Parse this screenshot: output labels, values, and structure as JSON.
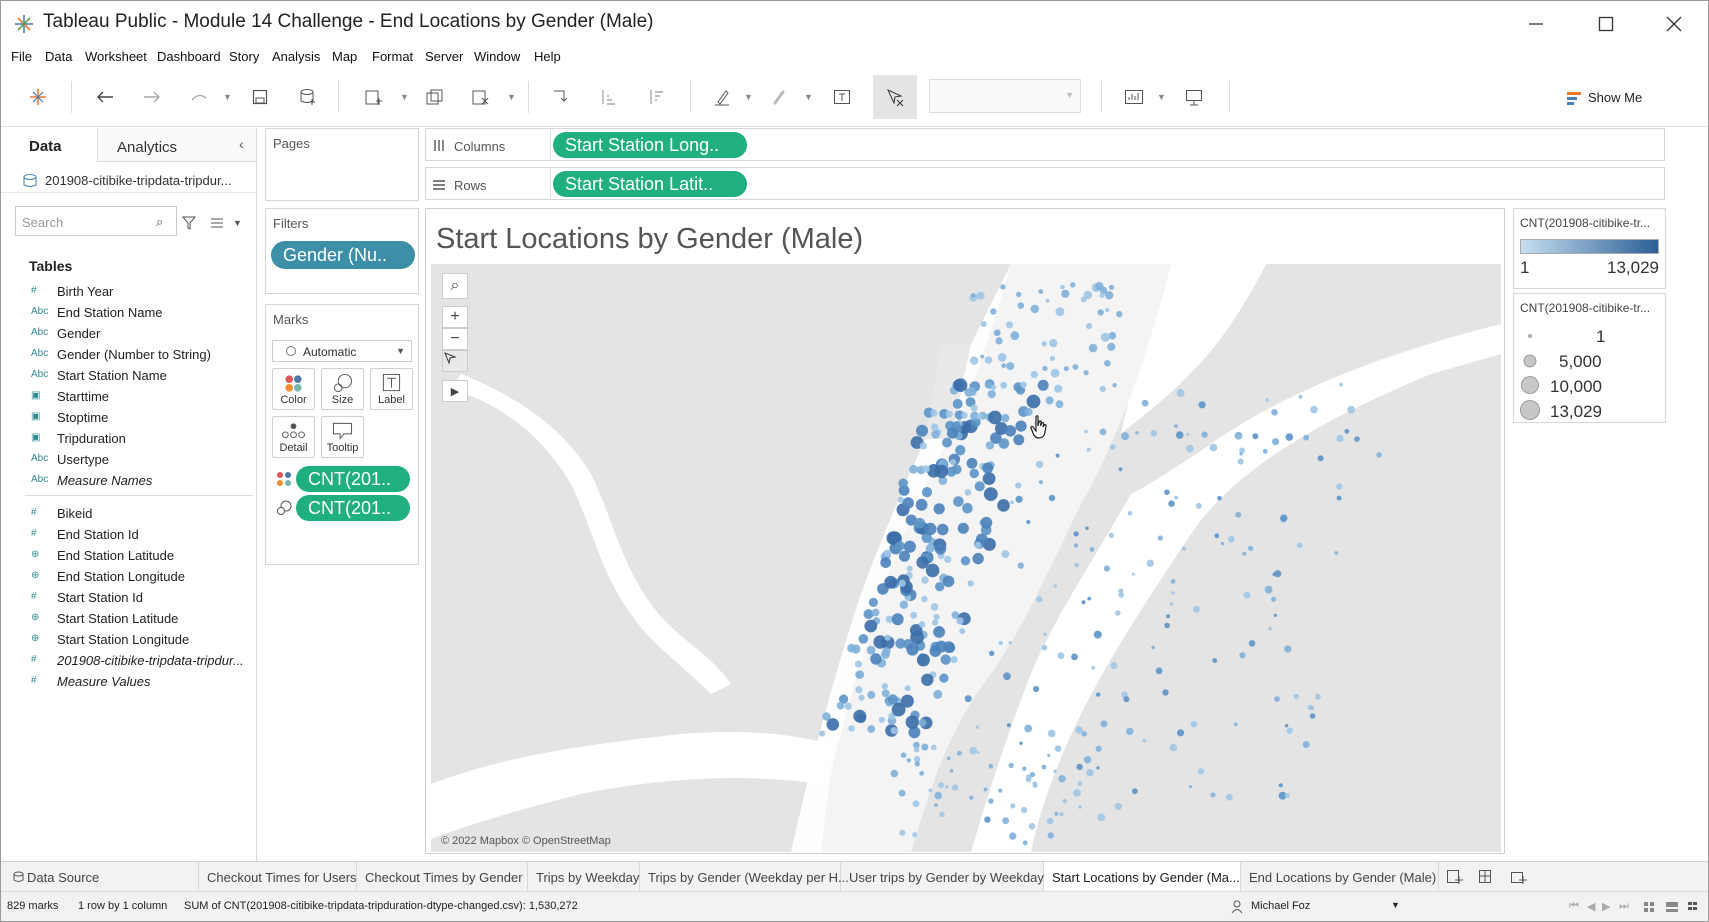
{
  "window": {
    "title": "Tableau Public - Module 14 Challenge - End Locations by Gender (Male)"
  },
  "menu": [
    "File",
    "Data",
    "Worksheet",
    "Dashboard",
    "Story",
    "Analysis",
    "Map",
    "Format",
    "Server",
    "Window",
    "Help"
  ],
  "toolbar": {
    "show_me_label": "Show Me"
  },
  "left_panel": {
    "tab_data": "Data",
    "tab_analytics": "Analytics",
    "datasource": "201908-citibike-tripdata-tripdur...",
    "search_placeholder": "Search",
    "tables_heading": "Tables",
    "dimensions": [
      {
        "type": "#",
        "name": "Birth Year"
      },
      {
        "type": "Abc",
        "name": "End Station Name"
      },
      {
        "type": "Abc",
        "name": "Gender"
      },
      {
        "type": "Abc",
        "name": "Gender (Number to String)"
      },
      {
        "type": "Abc",
        "name": "Start Station Name"
      },
      {
        "type": "date",
        "name": "Starttime"
      },
      {
        "type": "date",
        "name": "Stoptime"
      },
      {
        "type": "date",
        "name": "Tripduration"
      },
      {
        "type": "Abc",
        "name": "Usertype"
      },
      {
        "type": "Abc",
        "name": "Measure Names",
        "italic": true
      }
    ],
    "measures": [
      {
        "type": "#",
        "name": "Bikeid"
      },
      {
        "type": "#",
        "name": "End Station Id"
      },
      {
        "type": "globe",
        "name": "End Station Latitude"
      },
      {
        "type": "globe",
        "name": "End Station Longitude"
      },
      {
        "type": "#",
        "name": "Start Station Id"
      },
      {
        "type": "globe",
        "name": "Start Station Latitude"
      },
      {
        "type": "globe",
        "name": "Start Station Longitude"
      },
      {
        "type": "#",
        "name": "201908-citibike-tripdata-tripdur...",
        "italic": true
      },
      {
        "type": "#",
        "name": "Measure Values",
        "italic": true
      }
    ]
  },
  "pages": {
    "label": "Pages"
  },
  "filters": {
    "label": "Filters",
    "pill": "Gender (Nu.."
  },
  "marks": {
    "label": "Marks",
    "type": "Automatic",
    "buttons": [
      "Color",
      "Size",
      "Label",
      "Detail",
      "Tooltip"
    ],
    "pills": [
      "CNT(201..",
      "CNT(201.."
    ]
  },
  "shelves": {
    "columns_label": "Columns",
    "columns_pill": "Start Station Long..",
    "rows_label": "Rows",
    "rows_pill": "Start Station Latit.."
  },
  "viz": {
    "title": "Start Locations by Gender (Male)",
    "attribution": "© 2022 Mapbox © OpenStreetMap"
  },
  "legend_color": {
    "title": "CNT(201908-citibike-tr...",
    "min": "1",
    "max": "13,029",
    "color_low": "#c6def0",
    "color_high": "#2c5f95"
  },
  "legend_size": {
    "title": "CNT(201908-citibike-tr...",
    "items": [
      "1",
      "5,000",
      "10,000",
      "13,029"
    ]
  },
  "sheet_tabs": [
    "Data Source",
    "Checkout Times for Users",
    "Checkout Times by Gender",
    "Trips by Weekday",
    "Trips by Gender (Weekday per H...",
    "User trips by Gender by Weekday",
    "Start Locations by Gender (Ma...",
    "End Locations by Gender (Male)"
  ],
  "status": {
    "marks": "829 marks",
    "dims": "1 row by 1 column",
    "sum": "SUM of CNT(201908-citibike-tripdata-tripduration-dtype-changed.csv): 1,530,272",
    "user": "Michael Foz"
  }
}
